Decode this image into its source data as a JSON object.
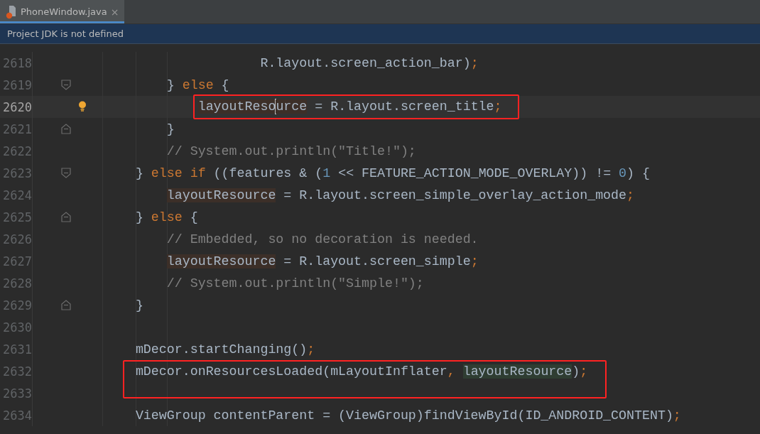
{
  "tabs": [
    {
      "label": "PhoneWindow.java",
      "close": "×",
      "selected": true
    }
  ],
  "banner": {
    "text": "Project JDK is not defined"
  },
  "lines": [
    {
      "number": "2618",
      "fold_open": false,
      "fold_close": false,
      "current": false,
      "annotated": false,
      "tokens": [
        {
          "kind": "plain",
          "text": "                    R.layout.screen_action_bar)"
        },
        {
          "kind": "punct",
          "text": ";"
        }
      ]
    },
    {
      "number": "2619",
      "fold_open": true,
      "fold_close": false,
      "current": false,
      "annotated": false,
      "tokens": [
        {
          "kind": "plain",
          "text": "        } "
        },
        {
          "kind": "keyword",
          "text": "else"
        },
        {
          "kind": "plain",
          "text": " {"
        }
      ]
    },
    {
      "number": "2620",
      "fold_open": false,
      "fold_close": false,
      "current": true,
      "annotated": true,
      "tokens": [
        {
          "kind": "write",
          "text": "            layoutReso"
        },
        {
          "kind": "caret"
        },
        {
          "kind": "write",
          "text": "urce"
        },
        {
          "kind": "plain",
          "text": " = R.layout.screen_title"
        },
        {
          "kind": "punct",
          "text": ";"
        }
      ]
    },
    {
      "number": "2621",
      "fold_open": false,
      "fold_close": true,
      "current": false,
      "annotated": false,
      "tokens": [
        {
          "kind": "plain",
          "text": "        }"
        }
      ]
    },
    {
      "number": "2622",
      "fold_open": false,
      "fold_close": false,
      "current": false,
      "annotated": false,
      "tokens": [
        {
          "kind": "comment",
          "text": "        // System.out.println(\"Title!\");"
        }
      ]
    },
    {
      "number": "2623",
      "fold_open": true,
      "fold_close": false,
      "current": false,
      "annotated": false,
      "tokens": [
        {
          "kind": "plain",
          "text": "    } "
        },
        {
          "kind": "keyword",
          "text": "else if"
        },
        {
          "kind": "plain",
          "text": " ((features & ("
        },
        {
          "kind": "number",
          "text": "1"
        },
        {
          "kind": "plain",
          "text": " << FEATURE_ACTION_MODE_OVERLAY)) != "
        },
        {
          "kind": "number",
          "text": "0"
        },
        {
          "kind": "plain",
          "text": ") {"
        }
      ]
    },
    {
      "number": "2624",
      "fold_open": false,
      "fold_close": false,
      "current": false,
      "annotated": false,
      "tokens": [
        {
          "kind": "write",
          "text": "        layoutResource"
        },
        {
          "kind": "plain",
          "text": " = R.layout.screen_simple_overlay_action_mode"
        },
        {
          "kind": "punct",
          "text": ";"
        }
      ]
    },
    {
      "number": "2625",
      "fold_open": false,
      "fold_close": true,
      "current": false,
      "annotated": false,
      "tokens": [
        {
          "kind": "plain",
          "text": "    } "
        },
        {
          "kind": "keyword",
          "text": "else"
        },
        {
          "kind": "plain",
          "text": " {"
        }
      ]
    },
    {
      "number": "2626",
      "fold_open": false,
      "fold_close": false,
      "current": false,
      "annotated": false,
      "tokens": [
        {
          "kind": "comment",
          "text": "        // Embedded, so no decoration is needed."
        }
      ]
    },
    {
      "number": "2627",
      "fold_open": false,
      "fold_close": false,
      "current": false,
      "annotated": false,
      "tokens": [
        {
          "kind": "write",
          "text": "        layoutResource"
        },
        {
          "kind": "plain",
          "text": " = R.layout.screen_simple"
        },
        {
          "kind": "punct",
          "text": ";"
        }
      ]
    },
    {
      "number": "2628",
      "fold_open": false,
      "fold_close": false,
      "current": false,
      "annotated": false,
      "tokens": [
        {
          "kind": "comment",
          "text": "        // System.out.println(\"Simple!\");"
        }
      ]
    },
    {
      "number": "2629",
      "fold_open": false,
      "fold_close": true,
      "current": false,
      "annotated": false,
      "tokens": [
        {
          "kind": "plain",
          "text": "    }"
        }
      ]
    },
    {
      "number": "2630",
      "fold_open": false,
      "fold_close": false,
      "current": false,
      "annotated": false
    },
    {
      "number": "2631",
      "fold_open": false,
      "fold_close": false,
      "current": false,
      "annotated": false,
      "tokens": [
        {
          "kind": "plain",
          "text": "    mDecor.startChanging()"
        },
        {
          "kind": "punct",
          "text": ";"
        }
      ]
    },
    {
      "number": "2632",
      "fold_open": false,
      "fold_close": false,
      "current": false,
      "annotated": true,
      "tokens": [
        {
          "kind": "plain",
          "text": "    mDecor.onResourcesLoaded(mLayoutInflater"
        },
        {
          "kind": "punct",
          "text": ", "
        },
        {
          "kind": "read",
          "text": "layoutResource"
        },
        {
          "kind": "plain",
          "text": ")"
        },
        {
          "kind": "punct",
          "text": ";"
        }
      ]
    },
    {
      "number": "2633",
      "fold_open": false,
      "fold_close": false,
      "current": false,
      "annotated": false
    },
    {
      "number": "2634",
      "fold_open": false,
      "fold_close": false,
      "current": false,
      "annotated": false,
      "tokens": [
        {
          "kind": "plain",
          "text": "    ViewGroup contentParent = (ViewGroup)findViewById(ID_ANDROID_CONTENT)"
        },
        {
          "kind": "punct",
          "text": ";"
        }
      ]
    }
  ]
}
